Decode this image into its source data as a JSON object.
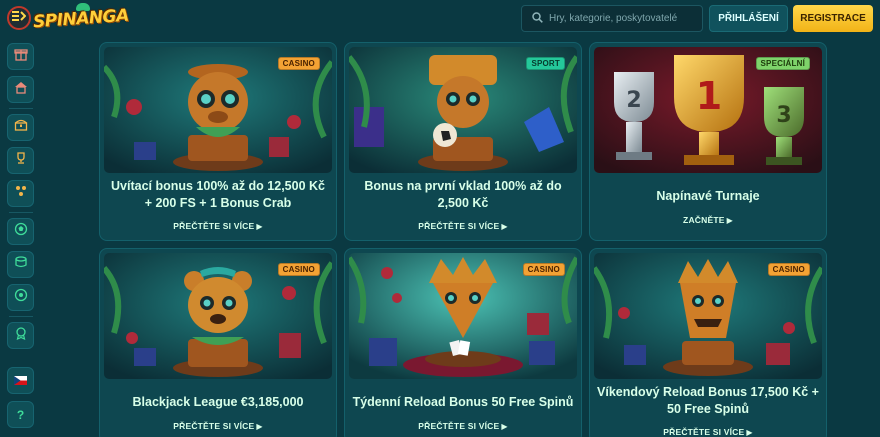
{
  "header": {
    "logo_text": "SPINANGA",
    "search_placeholder": "Hry, kategorie, poskytovatelé",
    "login_label": "PŘIHLÁŠENÍ",
    "register_label": "REGISTRACE"
  },
  "sidebar": {
    "items": [
      {
        "icon": "gift-icon"
      },
      {
        "icon": "tent-icon"
      },
      {
        "icon": "treasure-chest-icon"
      },
      {
        "icon": "trophy-icon"
      },
      {
        "icon": "dice-icon"
      },
      {
        "icon": "sport-ball-icon"
      },
      {
        "icon": "casino-chip-icon"
      },
      {
        "icon": "target-icon"
      },
      {
        "icon": "vip-badge-icon"
      },
      {
        "icon": "czech-flag-icon"
      },
      {
        "icon": "help-icon",
        "label": "?"
      }
    ]
  },
  "promos": [
    {
      "badge": "CASINO",
      "title": "Uvítací bonus 100% až do 12,500 Kč + 200 FS + 1 Bonus Crab",
      "link": "PŘEČTĚTE SI VÍCE"
    },
    {
      "badge": "SPORT",
      "title": "Bonus na první vklad 100% až do 2,500 Kč",
      "link": "PŘEČTĚTE SI VÍCE"
    },
    {
      "badge": "SPECIÁLNÍ",
      "title": "Napínavé Turnaje",
      "link": "ZAČNĚTE"
    },
    {
      "badge": "CASINO",
      "title": "Blackjack League €3,185,000",
      "link": "PŘEČTĚTE SI VÍCE"
    },
    {
      "badge": "CASINO",
      "title": "Týdenní Reload Bonus 50 Free Spinů",
      "link": "PŘEČTĚTE SI VÍCE"
    },
    {
      "badge": "CASINO",
      "title": "Víkendový Reload Bonus 17,500 Kč + 50 Free Spinů",
      "link": "PŘEČTĚTE SI VÍCE"
    }
  ],
  "trophy_numbers": [
    "2",
    "1",
    "3"
  ],
  "colors": {
    "accent_yellow": "#f2b317",
    "casino_badge": "#f3a234",
    "sport_badge": "#24c89a",
    "special_badge": "#7ed36a",
    "background": "#0a3942"
  }
}
